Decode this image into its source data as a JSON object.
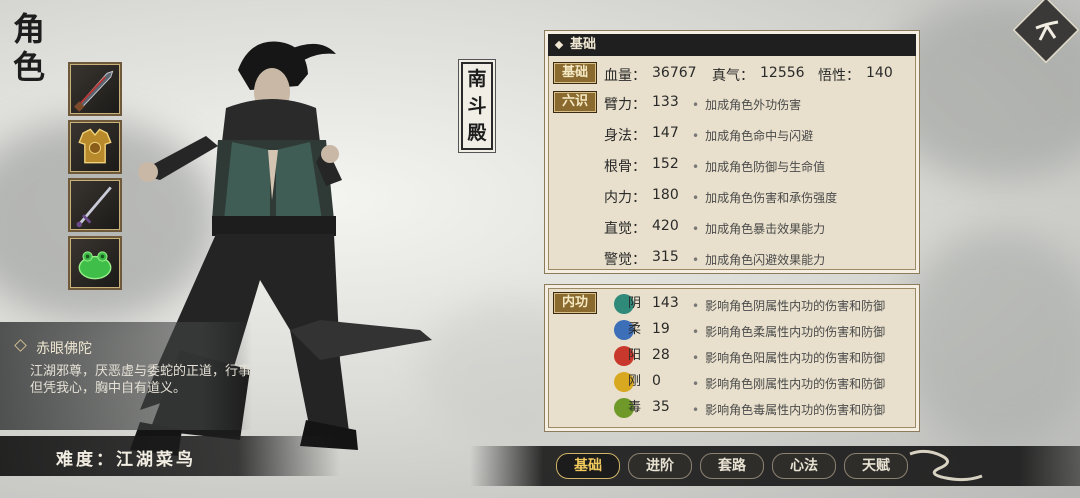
{
  "page": {
    "title": "角色"
  },
  "equipment": [
    {
      "name": "blade-icon"
    },
    {
      "name": "armor-icon"
    },
    {
      "name": "sword-icon"
    },
    {
      "name": "jade-toad-icon"
    }
  ],
  "character": {
    "name": "赤眼佛陀",
    "description": "江湖邪尊，厌恶虚与委蛇的正道，行事但凭我心，胸中自有道义。",
    "difficulty": "难度：江湖菜鸟",
    "faction": [
      "南",
      "斗",
      "殿"
    ]
  },
  "basic": {
    "header": "基础",
    "tag_basic": "基础",
    "tag_six": "六识",
    "summary": {
      "hp_label": "血量：",
      "hp": "36767",
      "qi_label": "真气：",
      "qi": "12556",
      "wu_label": "悟性：",
      "wu": "140"
    },
    "stats": [
      {
        "label": "臂力：",
        "value": "133",
        "desc": "加成角色外功伤害"
      },
      {
        "label": "身法：",
        "value": "147",
        "desc": "加成角色命中与闪避"
      },
      {
        "label": "根骨：",
        "value": "152",
        "desc": "加成角色防御与生命值"
      },
      {
        "label": "内力：",
        "value": "180",
        "desc": "加成角色伤害和承伤强度"
      },
      {
        "label": "直觉：",
        "value": "420",
        "desc": "加成角色暴击效果能力"
      },
      {
        "label": "警觉：",
        "value": "315",
        "desc": "加成角色闪避效果能力"
      }
    ]
  },
  "inner": {
    "tag": "内功",
    "elements": [
      {
        "char": "阴",
        "value": "143",
        "desc": "影响角色阴属性内功的伤害和防御",
        "color": "#2f8a7a"
      },
      {
        "char": "柔",
        "value": "19",
        "desc": "影响角色柔属性内功的伤害和防御",
        "color": "#3c6fb8"
      },
      {
        "char": "阳",
        "value": "28",
        "desc": "影响角色阳属性内功的伤害和防御",
        "color": "#c8382c"
      },
      {
        "char": "刚",
        "value": "0",
        "desc": "影响角色刚属性内功的伤害和防御",
        "color": "#d8a820"
      },
      {
        "char": "毒",
        "value": "35",
        "desc": "影响角色毒属性内功的伤害和防御",
        "color": "#6f9a2a"
      }
    ]
  },
  "tabs": [
    "基础",
    "进阶",
    "套路",
    "心法",
    "天赋"
  ],
  "active_tab": "基础"
}
